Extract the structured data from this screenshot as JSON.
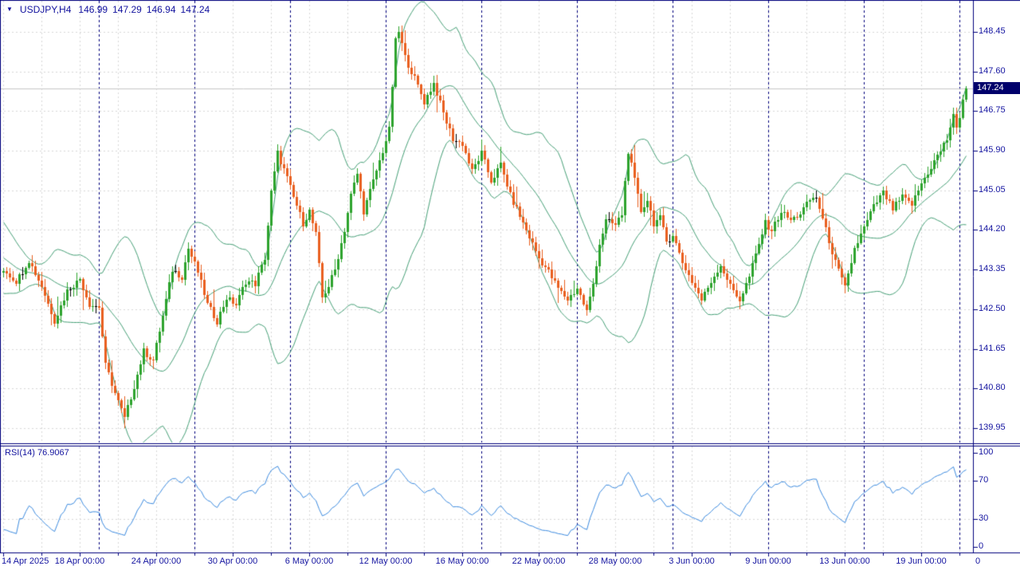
{
  "title": {
    "symbol_period": "USDJPY,H4",
    "open": "146.99",
    "high": "147.29",
    "low": "146.94",
    "close": "147.24"
  },
  "icons": {
    "symbol_menu_glyph": "▼"
  },
  "price_axis": {
    "labels": [
      "148.45",
      "147.60",
      "146.75",
      "145.90",
      "145.05",
      "144.20",
      "143.35",
      "142.50",
      "141.65",
      "140.80",
      "139.95"
    ],
    "current": "147.24"
  },
  "time_axis": {
    "labels": [
      {
        "text": "14 Apr 2025",
        "bar": 0,
        "align": "left"
      },
      {
        "text": "18 Apr 00:00",
        "bar": 24
      },
      {
        "text": "24 Apr 00:00",
        "bar": 48
      },
      {
        "text": "30 Apr 00:00",
        "bar": 72
      },
      {
        "text": "6 May 00:00",
        "bar": 96
      },
      {
        "text": "12 May 00:00",
        "bar": 120
      },
      {
        "text": "16 May 00:00",
        "bar": 144
      },
      {
        "text": "22 May 00:00",
        "bar": 168
      },
      {
        "text": "28 May 00:00",
        "bar": 192
      },
      {
        "text": "3 Jun 00:00",
        "bar": 216
      },
      {
        "text": "9 Jun 00:00",
        "bar": 240
      },
      {
        "text": "13 Jun 00:00",
        "bar": 264
      },
      {
        "text": "19 Jun 00:00",
        "bar": 288
      }
    ],
    "overflow_label": "0"
  },
  "rsi_panel": {
    "label": "RSI(14) 76.9067",
    "current_value": 76.9067,
    "axis_labels": [
      "100",
      "70",
      "30",
      "0"
    ],
    "levels": [
      70,
      30
    ]
  },
  "chart_data": {
    "type": "candlestick",
    "symbol": "USDJPY",
    "timeframe": "H4",
    "title": "USDJPY,H4  146.99 147.29 146.94 147.24",
    "bars_visible": 303,
    "prehistory_bars": 30,
    "price_axis": {
      "first_tick": 148.45,
      "tick_step": 0.85,
      "last_tick": 139.95,
      "top_of_pane": 149.13,
      "bottom_of_pane": 139.66
    },
    "last_bar": {
      "open": 146.99,
      "high": 147.29,
      "low": 146.94,
      "close": 147.24
    },
    "forced_extremes": {
      "low_bar": 38,
      "low": 139.95,
      "high_bar": 124,
      "high": 148.57
    },
    "week_separator_bars": [
      30,
      60,
      90,
      120,
      150,
      180,
      210,
      240,
      270,
      300
    ],
    "indicators": [
      {
        "type": "BollingerBands",
        "period": 20,
        "deviations": 2
      },
      {
        "type": "RSI",
        "period": 14,
        "current": 76.9067,
        "levels": [
          70,
          30
        ]
      }
    ],
    "close_waypoints": [
      [
        -30,
        145.3
      ],
      [
        -22,
        144.5
      ],
      [
        -14,
        143.9
      ],
      [
        -8,
        143.4
      ],
      [
        -4,
        143.1
      ],
      [
        0,
        143.35
      ],
      [
        4,
        143.1
      ],
      [
        8,
        143.55
      ],
      [
        12,
        143.0
      ],
      [
        16,
        142.25
      ],
      [
        20,
        142.9
      ],
      [
        24,
        143.15
      ],
      [
        27,
        142.6
      ],
      [
        30,
        142.55
      ],
      [
        32,
        141.3
      ],
      [
        35,
        140.7
      ],
      [
        38,
        140.15
      ],
      [
        41,
        140.85
      ],
      [
        44,
        141.6
      ],
      [
        47,
        141.4
      ],
      [
        50,
        142.35
      ],
      [
        53,
        143.35
      ],
      [
        56,
        143.2
      ],
      [
        58,
        143.8
      ],
      [
        61,
        143.3
      ],
      [
        64,
        142.6
      ],
      [
        67,
        142.25
      ],
      [
        70,
        142.75
      ],
      [
        73,
        142.6
      ],
      [
        76,
        143.1
      ],
      [
        79,
        143.05
      ],
      [
        82,
        143.6
      ],
      [
        84,
        145.0
      ],
      [
        86,
        145.85
      ],
      [
        88,
        145.5
      ],
      [
        91,
        144.9
      ],
      [
        94,
        144.35
      ],
      [
        96,
        144.6
      ],
      [
        98,
        144.1
      ],
      [
        100,
        142.75
      ],
      [
        102,
        143.0
      ],
      [
        104,
        143.35
      ],
      [
        107,
        144.2
      ],
      [
        109,
        144.95
      ],
      [
        111,
        145.4
      ],
      [
        113,
        144.6
      ],
      [
        116,
        145.25
      ],
      [
        119,
        145.9
      ],
      [
        121,
        146.35
      ],
      [
        122,
        147.3
      ],
      [
        123,
        148.25
      ],
      [
        124,
        148.45
      ],
      [
        126,
        147.9
      ],
      [
        129,
        147.45
      ],
      [
        132,
        146.95
      ],
      [
        135,
        147.35
      ],
      [
        138,
        146.7
      ],
      [
        141,
        146.15
      ],
      [
        144,
        146.05
      ],
      [
        147,
        145.45
      ],
      [
        150,
        145.85
      ],
      [
        153,
        145.25
      ],
      [
        156,
        145.6
      ],
      [
        159,
        144.95
      ],
      [
        162,
        144.5
      ],
      [
        165,
        144.05
      ],
      [
        168,
        143.6
      ],
      [
        171,
        143.3
      ],
      [
        174,
        142.95
      ],
      [
        177,
        142.7
      ],
      [
        180,
        142.95
      ],
      [
        183,
        142.45
      ],
      [
        185,
        143.05
      ],
      [
        187,
        143.9
      ],
      [
        189,
        144.4
      ],
      [
        192,
        144.3
      ],
      [
        194,
        144.55
      ],
      [
        196,
        145.9
      ],
      [
        198,
        145.25
      ],
      [
        200,
        144.6
      ],
      [
        202,
        144.85
      ],
      [
        204,
        144.35
      ],
      [
        206,
        144.45
      ],
      [
        208,
        143.95
      ],
      [
        210,
        144.1
      ],
      [
        213,
        143.5
      ],
      [
        216,
        143.1
      ],
      [
        219,
        142.7
      ],
      [
        222,
        143.1
      ],
      [
        225,
        143.45
      ],
      [
        228,
        143.0
      ],
      [
        231,
        142.7
      ],
      [
        234,
        143.2
      ],
      [
        237,
        143.9
      ],
      [
        239,
        144.35
      ],
      [
        241,
        144.2
      ],
      [
        244,
        144.6
      ],
      [
        247,
        144.4
      ],
      [
        250,
        144.55
      ],
      [
        253,
        144.85
      ],
      [
        255,
        144.9
      ],
      [
        258,
        144.2
      ],
      [
        261,
        143.5
      ],
      [
        264,
        142.95
      ],
      [
        267,
        143.8
      ],
      [
        270,
        144.25
      ],
      [
        273,
        144.7
      ],
      [
        276,
        145.0
      ],
      [
        279,
        144.65
      ],
      [
        282,
        144.9
      ],
      [
        285,
        144.75
      ],
      [
        288,
        145.2
      ],
      [
        291,
        145.55
      ],
      [
        294,
        145.9
      ],
      [
        296,
        146.15
      ],
      [
        298,
        146.7
      ],
      [
        299,
        146.35
      ],
      [
        300,
        146.6
      ],
      [
        301,
        146.99
      ],
      [
        302,
        147.24
      ]
    ]
  },
  "colors": {
    "background": "#FFFFFF",
    "bull": "#2DA32D",
    "bear": "#E95F1F",
    "doji": "#000000",
    "bollinger": "#46A077",
    "rsi_line": "#3C8BE0",
    "grid": "#D8D8D8",
    "separator": "#00007D",
    "axis_text": "#1414A0",
    "current_price_line": "#C8C8C8",
    "tag_bg": "#00006B",
    "tag_text": "#FFFFFF"
  }
}
